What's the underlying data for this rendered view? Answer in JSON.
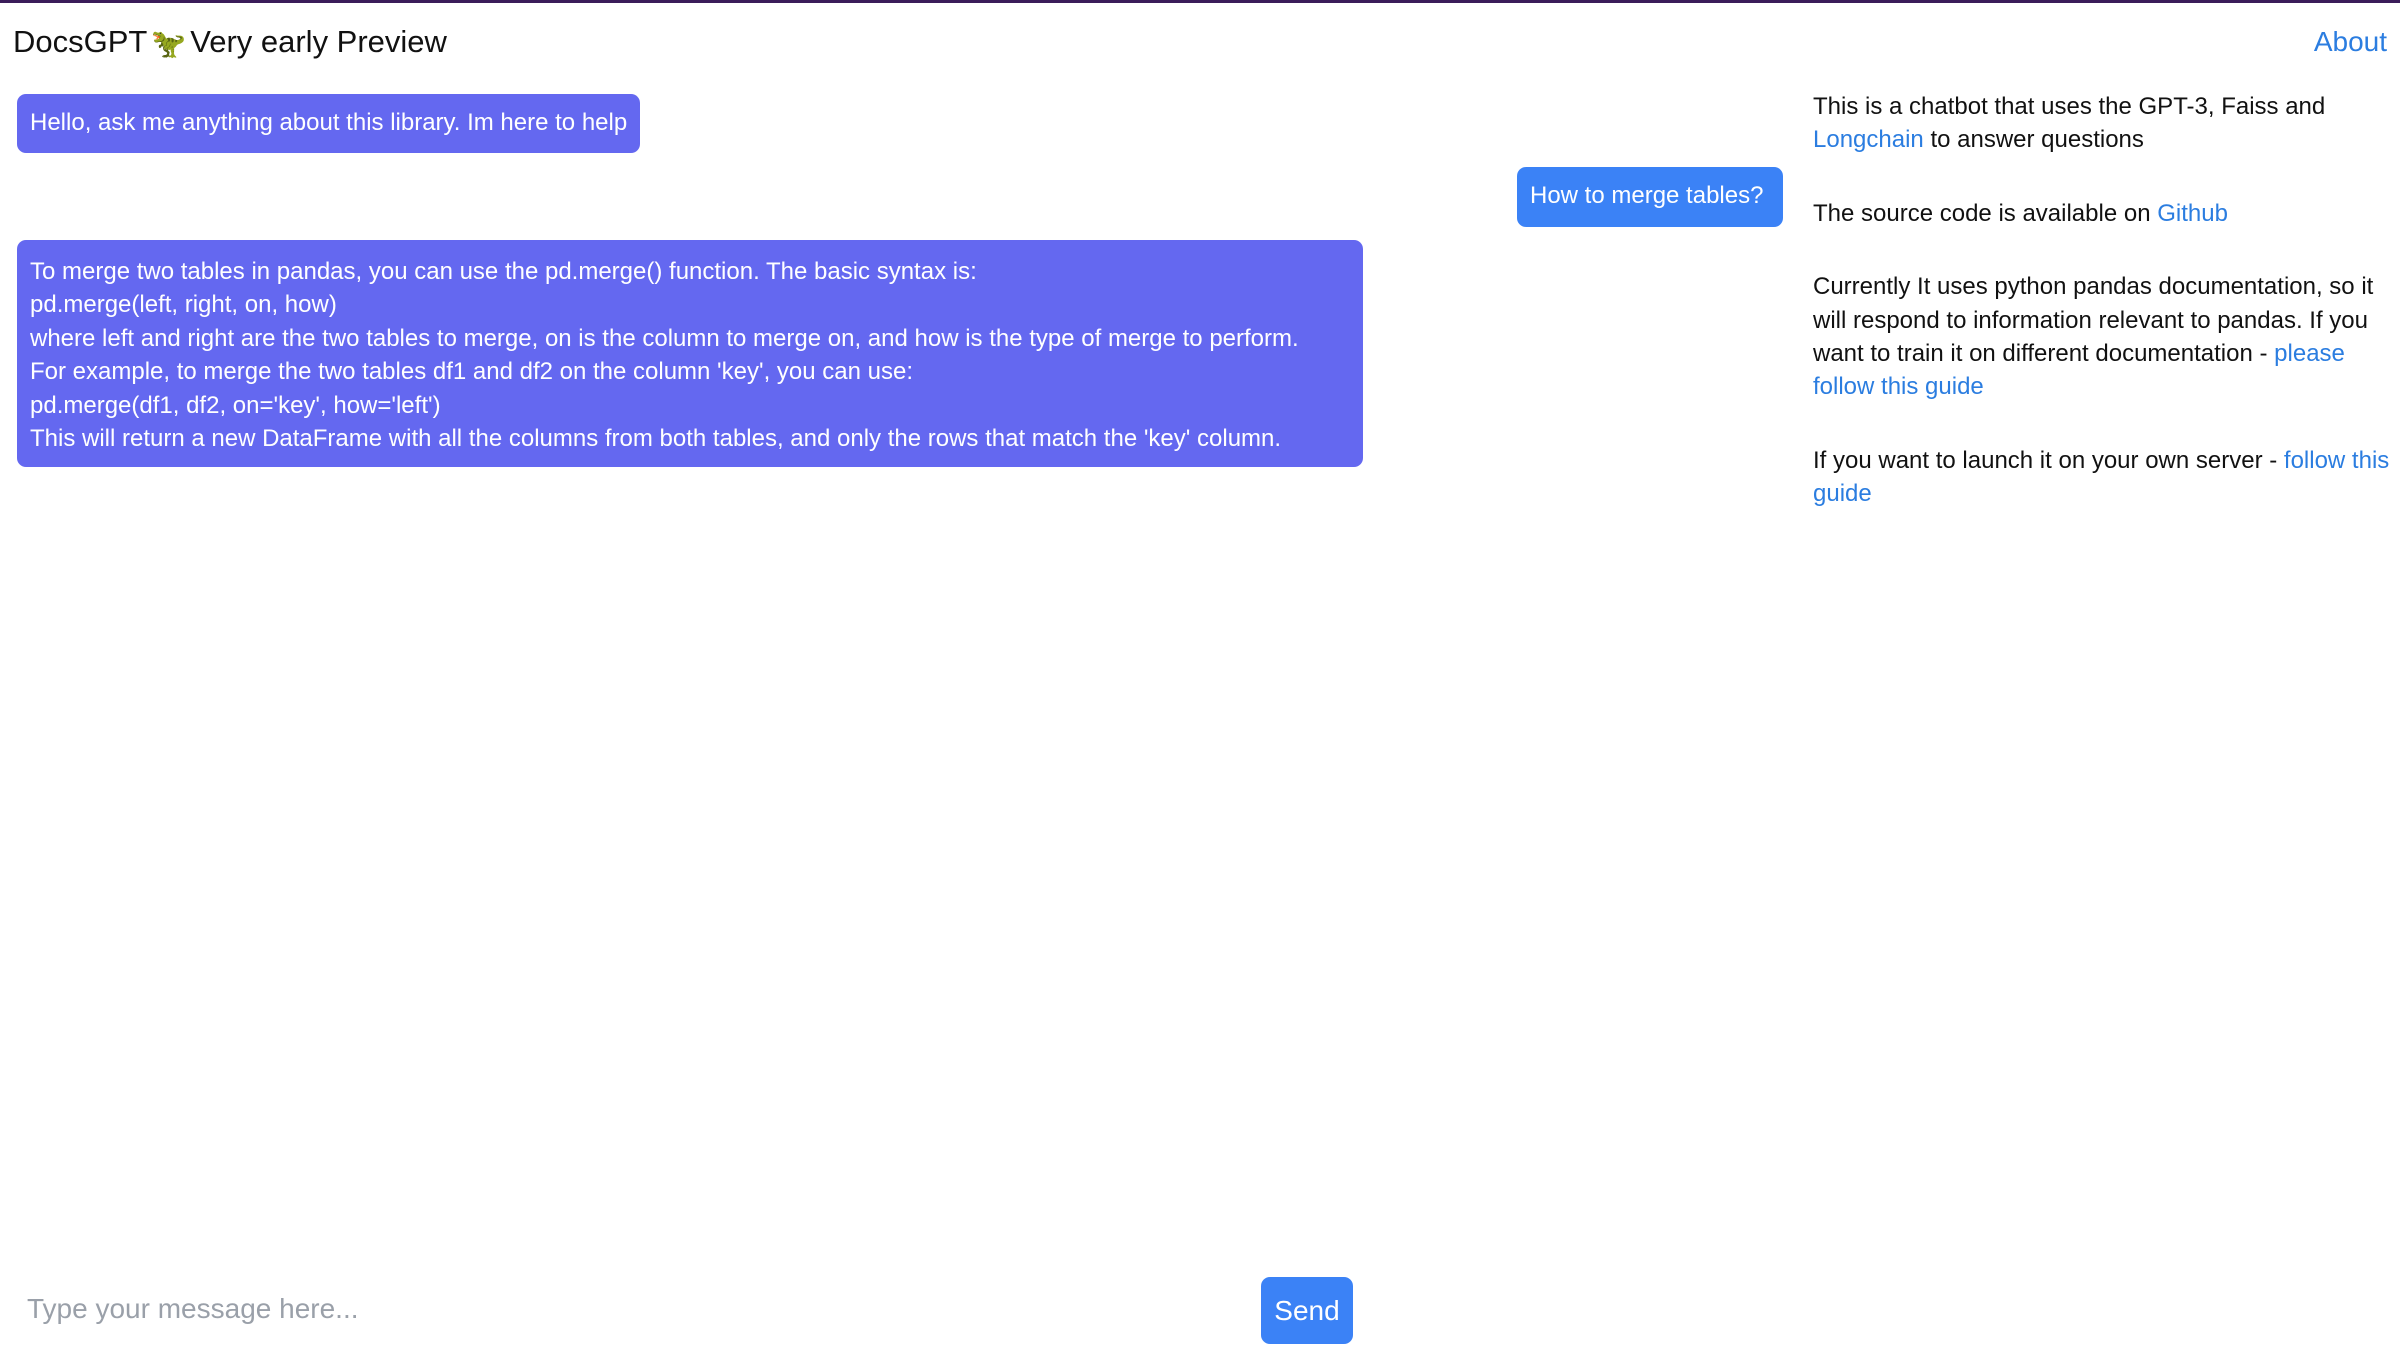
{
  "header": {
    "app_name": "DocsGPT",
    "icon": "dinosaur-icon",
    "icon_glyph": "🦖",
    "subtitle": "Very early Preview",
    "about_label": "About"
  },
  "conversation": {
    "greeting": "Hello, ask me anything about this library. Im here to help",
    "question": "How to merge tables?",
    "answer_lines": [
      "To merge two tables in pandas, you can use the pd.merge() function. The basic syntax is:",
      "pd.merge(left, right, on, how)",
      "where left and right are the two tables to merge, on is the column to merge on, and how is the type of merge to perform.",
      "For example, to merge the two tables df1 and df2 on the column 'key', you can use:",
      "pd.merge(df1, df2, on='key', how='left')",
      "This will return a new DataFrame with all the columns from both tables, and only the rows that match the 'key' column."
    ]
  },
  "sidebar": {
    "p1_text_a": "This is a chatbot that uses the GPT-3, Faiss and",
    "p1_link": "Longchain",
    "p1_text_b": "to answer questions",
    "p2_text": "The source code is available on",
    "p2_link": "Github",
    "p3_text": "Currently It uses python pandas documentation, so it will respond to information relevant to pandas. If you want to train it on different documentation -",
    "p3_link": "please follow this guide",
    "p4_text": "If you want to launch it on your own server -",
    "p4_link": "follow this guide"
  },
  "composer": {
    "placeholder": "Type your message here...",
    "send_label": "Send"
  },
  "colors": {
    "bot_bubble": "#6468f0",
    "user_bubble": "#3b82f6",
    "link": "#2b7de0",
    "top_border": "#3b1d5a"
  }
}
